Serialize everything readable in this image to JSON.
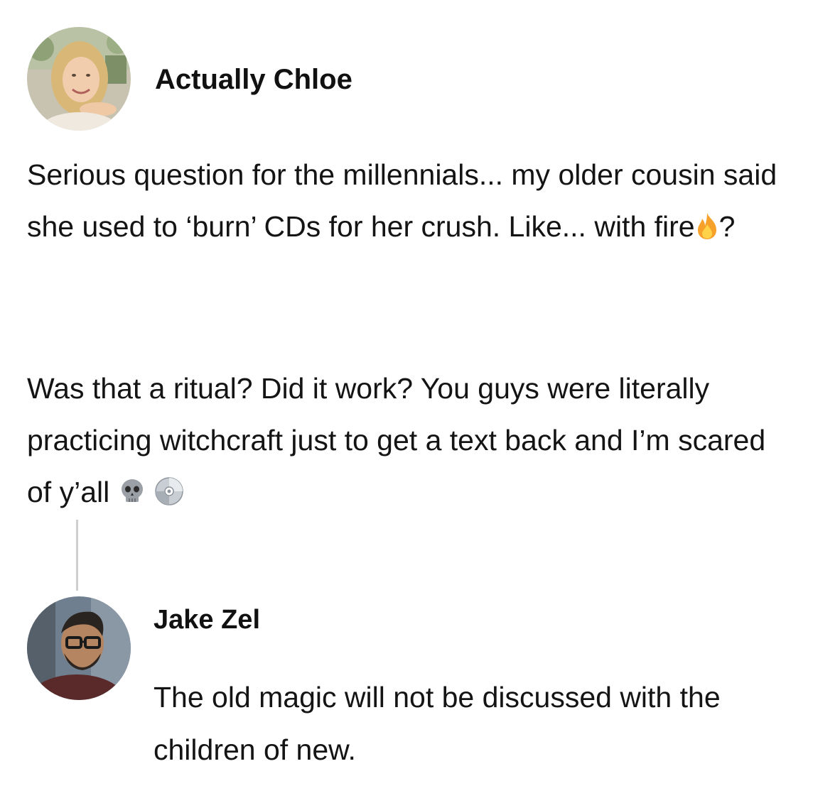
{
  "post": {
    "author": "Actually Chloe",
    "avatar_icon": "person-photo-avatar-icon",
    "paragraph1": {
      "text": "Serious question for the millennials... my older cousin said she used to ‘burn’ CDs for her crush. Like... with fire",
      "emoji": "fire-emoji-icon",
      "suffix": "?"
    },
    "paragraph2": {
      "text": "Was that a ritual? Did it work? You guys were literally practicing witchcraft just to get a text back and I’m scared of y’all",
      "emojis": [
        "skull-emoji-icon",
        "cd-disc-emoji-icon"
      ]
    }
  },
  "reply": {
    "author": "Jake Zel",
    "avatar_icon": "person-photo-avatar-icon",
    "text": "The old magic will not be discussed with the children of new."
  },
  "colors": {
    "background": "#ffffff",
    "text": "#141414",
    "thread_line": "#cfcfcf",
    "fire_outer": "#f7a12a",
    "fire_inner": "#ffd24a",
    "skull": "#9aa0a6",
    "disc": "#c9ced4"
  }
}
